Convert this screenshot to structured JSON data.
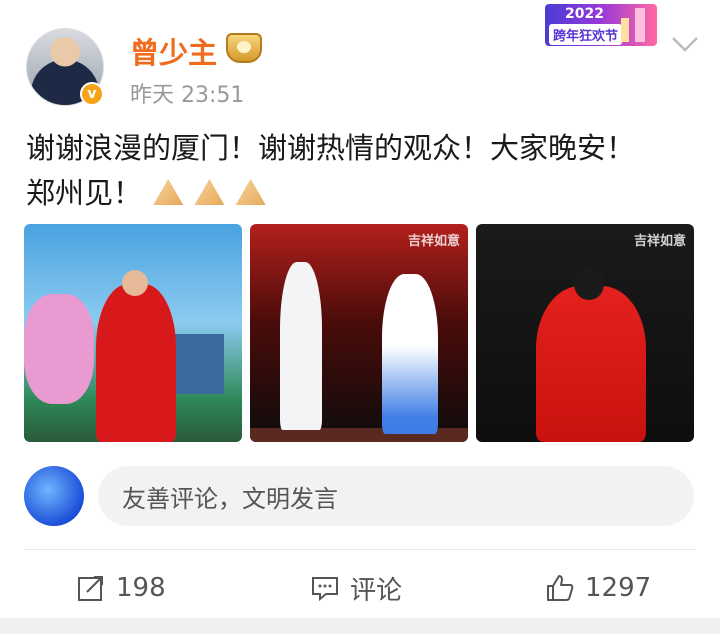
{
  "post": {
    "username": "曾少主",
    "timestamp": "昨天 23:51",
    "text_line1": "谢谢浪漫的厦门！谢谢热情的观众！大家晚安！",
    "text_line2": "郑州见！",
    "badge_icon": "verified-icon",
    "vip_icon": "vip-crown-icon"
  },
  "festival": {
    "year": "2022",
    "label": "跨年狂欢节"
  },
  "images": {
    "watermark": "吉祥如意",
    "items": [
      "stage-photo-red-suit",
      "stage-photo-duet",
      "stage-photo-red-dress"
    ]
  },
  "comment": {
    "placeholder": "友善评论，文明发言"
  },
  "actions": {
    "repost_count": "198",
    "comment_label": "评论",
    "like_count": "1297"
  },
  "colors": {
    "username": "#f06b1d",
    "verified": "#f7a31a",
    "text": "#1a1a1a",
    "meta": "#999999"
  }
}
